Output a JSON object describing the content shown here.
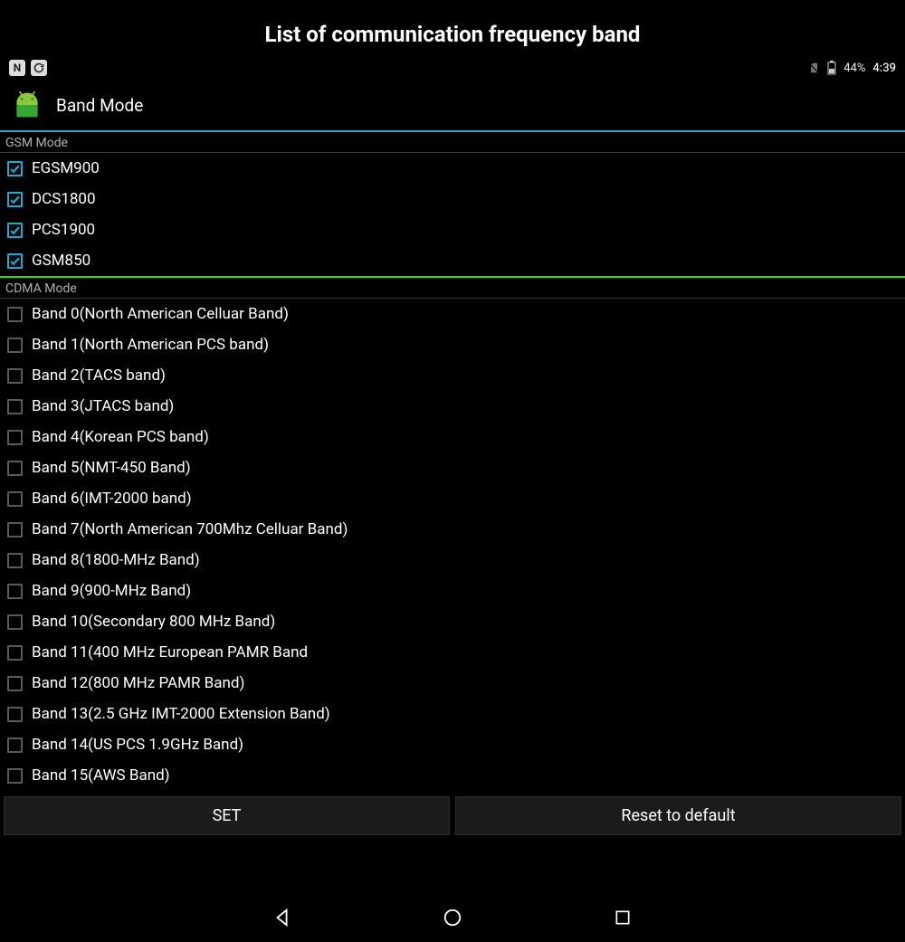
{
  "page_title": "List of communication frequency band",
  "status_bar": {
    "left_icons": [
      "letter-n-icon",
      "refresh-circle-icon"
    ],
    "battery_percent": "44%",
    "clock": "4:39"
  },
  "app_bar": {
    "title": "Band Mode"
  },
  "sections": [
    {
      "header": "GSM Mode",
      "divider": "blue",
      "items": [
        {
          "label": "EGSM900",
          "checked": true
        },
        {
          "label": "DCS1800",
          "checked": true
        },
        {
          "label": "PCS1900",
          "checked": true
        },
        {
          "label": "GSM850",
          "checked": true
        }
      ]
    },
    {
      "header": "CDMA Mode",
      "divider": "green",
      "items": [
        {
          "label": "Band 0(North American Celluar Band)",
          "checked": false
        },
        {
          "label": "Band 1(North American PCS band)",
          "checked": false
        },
        {
          "label": "Band 2(TACS band)",
          "checked": false
        },
        {
          "label": "Band 3(JTACS band)",
          "checked": false
        },
        {
          "label": "Band 4(Korean PCS band)",
          "checked": false
        },
        {
          "label": "Band 5(NMT-450 Band)",
          "checked": false
        },
        {
          "label": "Band 6(IMT-2000 band)",
          "checked": false
        },
        {
          "label": "Band 7(North American 700Mhz Celluar Band)",
          "checked": false
        },
        {
          "label": "Band 8(1800-MHz Band)",
          "checked": false
        },
        {
          "label": "Band 9(900-MHz Band)",
          "checked": false
        },
        {
          "label": "Band 10(Secondary 800 MHz Band)",
          "checked": false
        },
        {
          "label": "Band 11(400 MHz European PAMR Band",
          "checked": false
        },
        {
          "label": "Band 12(800 MHz PAMR Band)",
          "checked": false
        },
        {
          "label": "Band 13(2.5 GHz IMT-2000 Extension Band)",
          "checked": false
        },
        {
          "label": "Band 14(US PCS 1.9GHz Band)",
          "checked": false
        },
        {
          "label": "Band 15(AWS Band)",
          "checked": false
        }
      ]
    }
  ],
  "buttons": {
    "set": "SET",
    "reset": "Reset to default"
  }
}
